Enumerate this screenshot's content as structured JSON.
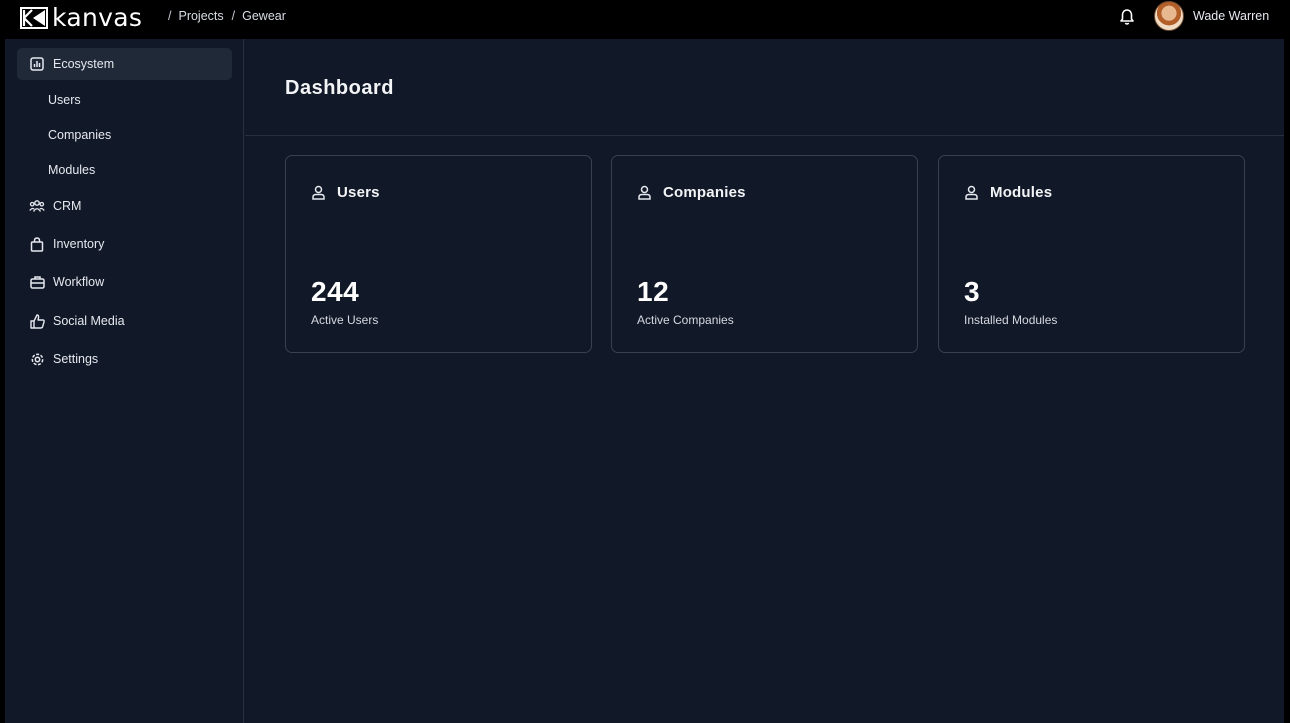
{
  "app": {
    "name": "kanvas"
  },
  "breadcrumb": {
    "separator": "/",
    "items": [
      "Projects",
      "Gewear"
    ]
  },
  "user": {
    "name": "Wade Warren"
  },
  "sidebar": {
    "items": [
      {
        "label": "Ecosystem",
        "icon": "bar-chart-icon",
        "active": true
      },
      {
        "label": "CRM",
        "icon": "users-group-icon"
      },
      {
        "label": "Inventory",
        "icon": "shopping-bag-icon"
      },
      {
        "label": "Workflow",
        "icon": "briefcase-icon"
      },
      {
        "label": "Social Media",
        "icon": "thumbs-up-icon"
      },
      {
        "label": "Settings",
        "icon": "gear-icon"
      }
    ],
    "subitems": [
      "Users",
      "Companies",
      "Modules"
    ]
  },
  "page": {
    "title": "Dashboard"
  },
  "cards": [
    {
      "title": "Users",
      "value": "244",
      "label": "Active Users",
      "icon": "users-icon"
    },
    {
      "title": "Companies",
      "value": "12",
      "label": "Active Companies",
      "icon": "users-icon"
    },
    {
      "title": "Modules",
      "value": "3",
      "label": "Installed Modules",
      "icon": "users-icon"
    }
  ],
  "colors": {
    "background": "#111827",
    "topbar": "#000000",
    "active_nav": "#1f2937",
    "border": "#374151"
  }
}
